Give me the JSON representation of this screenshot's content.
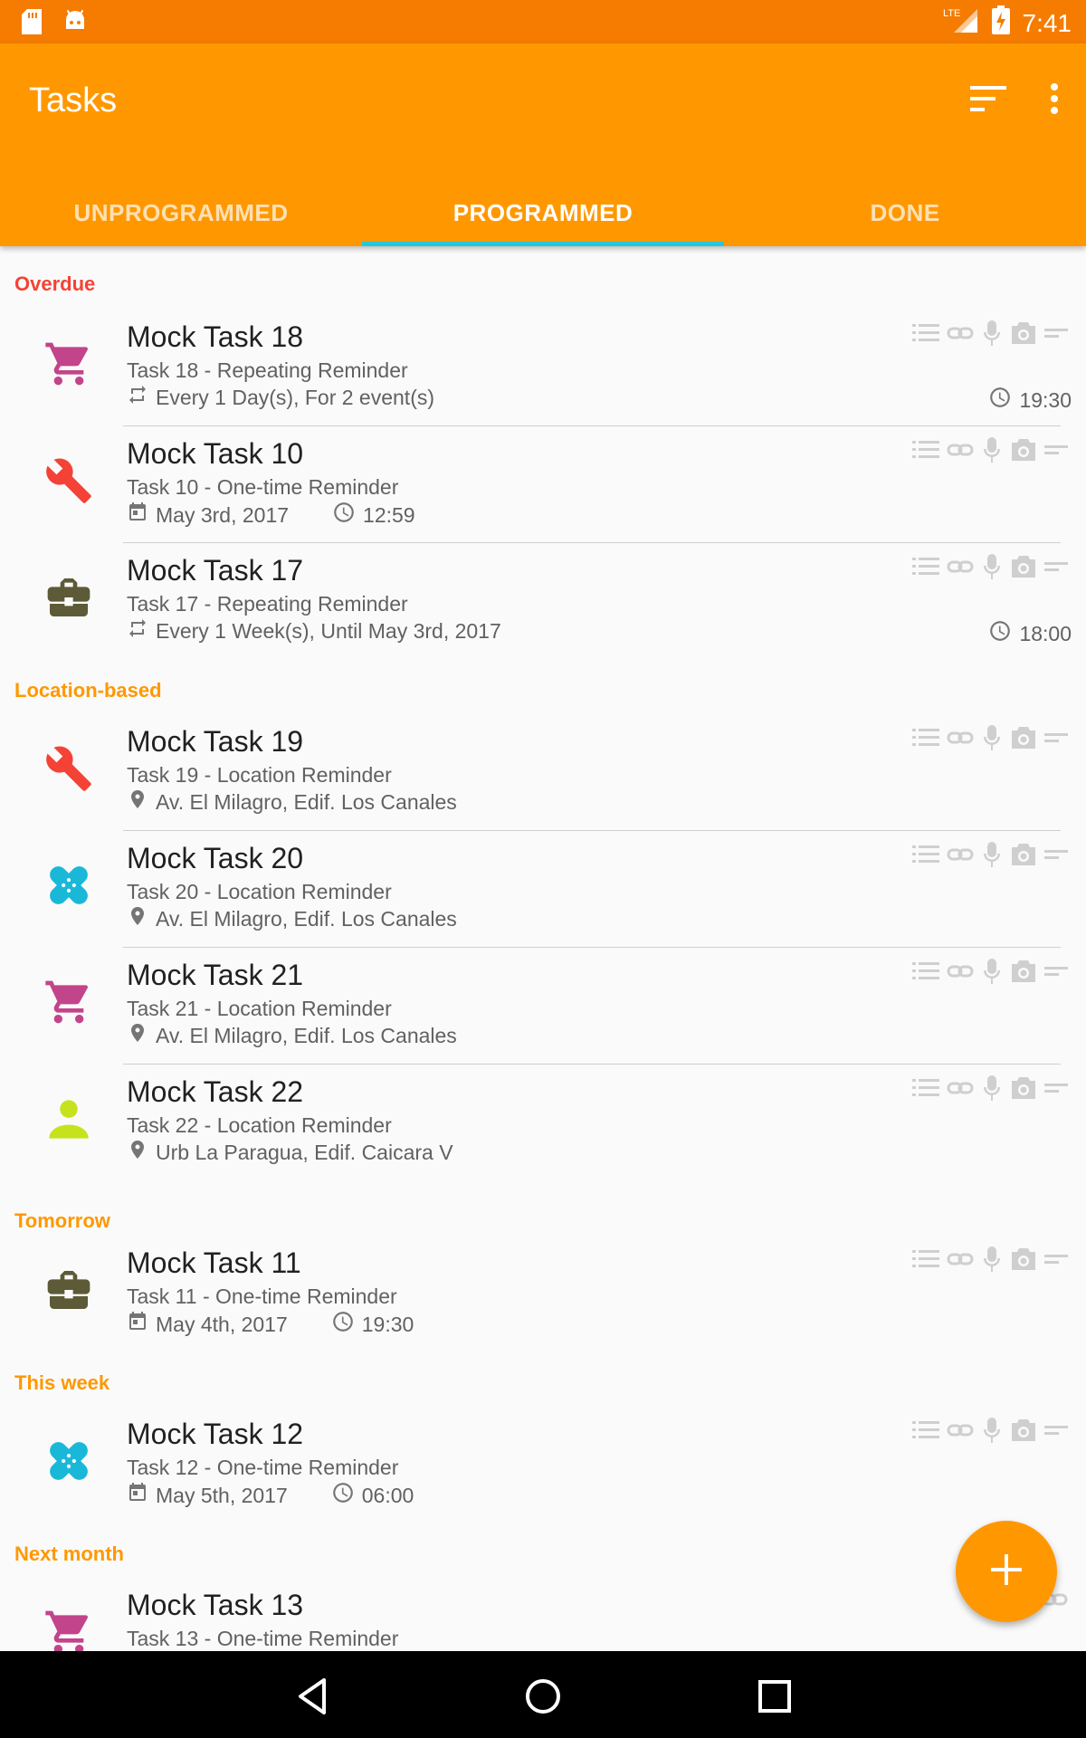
{
  "status_bar": {
    "time": "7:41",
    "network": "LTE"
  },
  "toolbar": {
    "title": "Tasks",
    "sort_icon": "sort-icon",
    "menu_icon": "more-vert-icon"
  },
  "tabs": [
    {
      "label": "UNPROGRAMMED"
    },
    {
      "label": "PROGRAMMED"
    },
    {
      "label": "DONE"
    }
  ],
  "sections": {
    "overdue": "Overdue",
    "location": "Location-based",
    "tomorrow": "Tomorrow",
    "week": "This week",
    "month": "Next month"
  },
  "tasks": [
    {
      "name": "Mock Task 18",
      "sub": "Task 18 - Repeating Reminder",
      "meta": "Every 1 Day(s), For 2 event(s)",
      "time": "19:30",
      "icon": "cart-icon"
    },
    {
      "name": "Mock Task 10",
      "sub": "Task 10 - One-time Reminder",
      "date": "May 3rd, 2017",
      "time": "12:59",
      "icon": "wrench-icon"
    },
    {
      "name": "Mock Task 17",
      "sub": "Task 17 - Repeating Reminder",
      "meta": "Every 1 Week(s), Until May 3rd, 2017",
      "time": "18:00",
      "icon": "briefcase-icon"
    },
    {
      "name": "Mock Task 19",
      "sub": "Task 19 - Location Reminder",
      "meta": "Av. El Milagro, Edif. Los Canales",
      "icon": "wrench-icon"
    },
    {
      "name": "Mock Task 20",
      "sub": "Task 20 - Location Reminder",
      "meta": "Av. El Milagro, Edif. Los Canales",
      "icon": "bandage-icon"
    },
    {
      "name": "Mock Task 21",
      "sub": "Task 21 - Location Reminder",
      "meta": "Av. El Milagro, Edif. Los Canales",
      "icon": "cart-icon"
    },
    {
      "name": "Mock Task 22",
      "sub": "Task 22 - Location Reminder",
      "meta": "Urb La Paragua, Edif. Caicara V",
      "icon": "person-icon"
    },
    {
      "name": "Mock Task 11",
      "sub": "Task 11 - One-time Reminder",
      "date": "May 4th, 2017",
      "time": "19:30",
      "icon": "briefcase-icon"
    },
    {
      "name": "Mock Task 12",
      "sub": "Task 12 - One-time Reminder",
      "date": "May 5th, 2017",
      "time": "06:00",
      "icon": "bandage-icon"
    },
    {
      "name": "Mock Task 13",
      "sub": "Task 13 - One-time Reminder",
      "icon": "cart-icon"
    }
  ],
  "colors": {
    "primary": "#ff9800",
    "primary_dark": "#f57c00",
    "accent": "#26c6da",
    "overdue": "#f44336",
    "cart": "#c2448a",
    "wrench": "#f44336",
    "briefcase": "#5d5a37",
    "bandage": "#1ab8d8",
    "person": "#c6e21c"
  },
  "fab": {
    "icon": "add-icon"
  }
}
